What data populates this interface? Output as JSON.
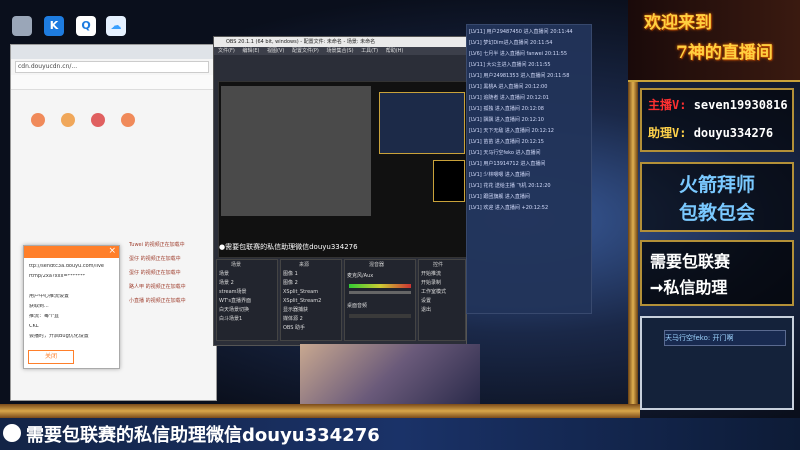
{
  "desktop": {
    "icons": [
      {
        "name": "app-icon-1",
        "color": "#9aa6b8",
        "glyph": ""
      },
      {
        "name": "kugou-icon",
        "color": "#1e7ce0",
        "glyph": "K"
      },
      {
        "name": "qq-icon",
        "color": "#ffffff",
        "glyph": "Q"
      },
      {
        "name": "cloud-icon",
        "color": "#3aa0ff",
        "glyph": "☁"
      }
    ]
  },
  "browser": {
    "address": "cdn.douyucdn.cn/...",
    "dialog": {
      "lines": [
        "ttp://sendtc3a.douyu.com/live",
        "rtmp/2xa?xxx=*******",
        "",
        "用户中心推流设置",
        "获取到...",
        "推流：每个直",
        "CKL",
        "会播时，开启Bug优化设置"
      ],
      "close_label": "关闭"
    },
    "rows": [
      "Tuwei 的视频正在加载中",
      "蛋仔  的视频正在加载中",
      "蛋仔  的视频正在加载中",
      "路人甲  的视频正在加载中",
      "小直播 的视频正在加载中"
    ]
  },
  "obs": {
    "title": "OBS 20.1.1 (64 bit, windows) - 配置文件: 未命名 - 场景: 未命名",
    "menu": [
      "文件(F)",
      "编辑(E)",
      "视图(V)",
      "配置文件(P)",
      "场景集合(S)",
      "工具(T)",
      "帮助(H)"
    ],
    "preview_caption": "●需要包联赛的私信助理微信douyu334276",
    "scenes_title": "场景",
    "scenes": [
      "场景",
      "场景 2",
      "stream场景",
      "WT's直播界面",
      "白天场景切换",
      "白斗场景1"
    ],
    "sources_title": "来源",
    "sources": [
      "图像 1",
      "图像 2",
      "XSplit_Stream",
      "XSplit_Stream2",
      "显示器捕获",
      "媒体源 2",
      "OBS 助手"
    ],
    "mixer_title": "混音器",
    "mixer": [
      "麦克风/Aux",
      "桌面音频"
    ],
    "controls_title": "控件",
    "controls": [
      "开始推流",
      "开始录制",
      "工作室模式",
      "设置",
      "退出"
    ]
  },
  "chat": {
    "lines": [
      "[LV11] 用户29487450 进入直播间  20:11:44",
      "[LV1] 梦幻Dim进入直播间  20:11:54",
      "[LV6] 七月半 进入直播间 fanwei  20:11:55",
      "[LV11] 大公主进入直播间  20:11:55",
      "[LV1] 用户24981353 进入直播间 20:11:58",
      "[LV1] 黑桃A 进入直播间  20:12:00",
      "[LV1] 追随者 进入直播间  20:12:01",
      "[LV1] 孤独 进入直播间  20:12:08",
      "[LV1] 飘飘 进入直播间  20:12:10",
      "[LV1] 天下无敌 进入直播间  20:12:12",
      "[LV1] 苗苗 进入直播间  20:12:15",
      "[LV1] 天马行空feko 进入直播间",
      "[LV1] 用户13914712 进入直播间",
      "[LV1] 少林嗯嗯 进入直播间",
      "[LV1] 花花 送给主播 飞机  20:12:20",
      "[LV1] 跟团旗舰 进入直播间",
      "[LV1] 欢迎 进入直播间 +20:12:52"
    ]
  },
  "stream": {
    "welcome_line1": "欢迎来到",
    "welcome_line2": "7神的直播间",
    "host_label": "主播V:",
    "host_id": "seven19930816",
    "assistant_label": "助理V:",
    "assistant_id": "douyu334276",
    "rocket_line1": "火箭拜师",
    "rocket_line2": "包教包会",
    "pkg_line1": "需要包联赛",
    "pkg_line2": "➞私信助理",
    "webcam_name": "天马行空feko: 开门啊",
    "bottom_text": "需要包联赛的私信助理微信douyu334276"
  },
  "colors": {
    "accent_gold": "#c9a23a",
    "welcome": "#ffd040",
    "host_red": "#ff3030",
    "assistant_yellow": "#ffd24a",
    "rocket_blue": "#7ac9ff",
    "bottom_bar": "#1a3268"
  }
}
